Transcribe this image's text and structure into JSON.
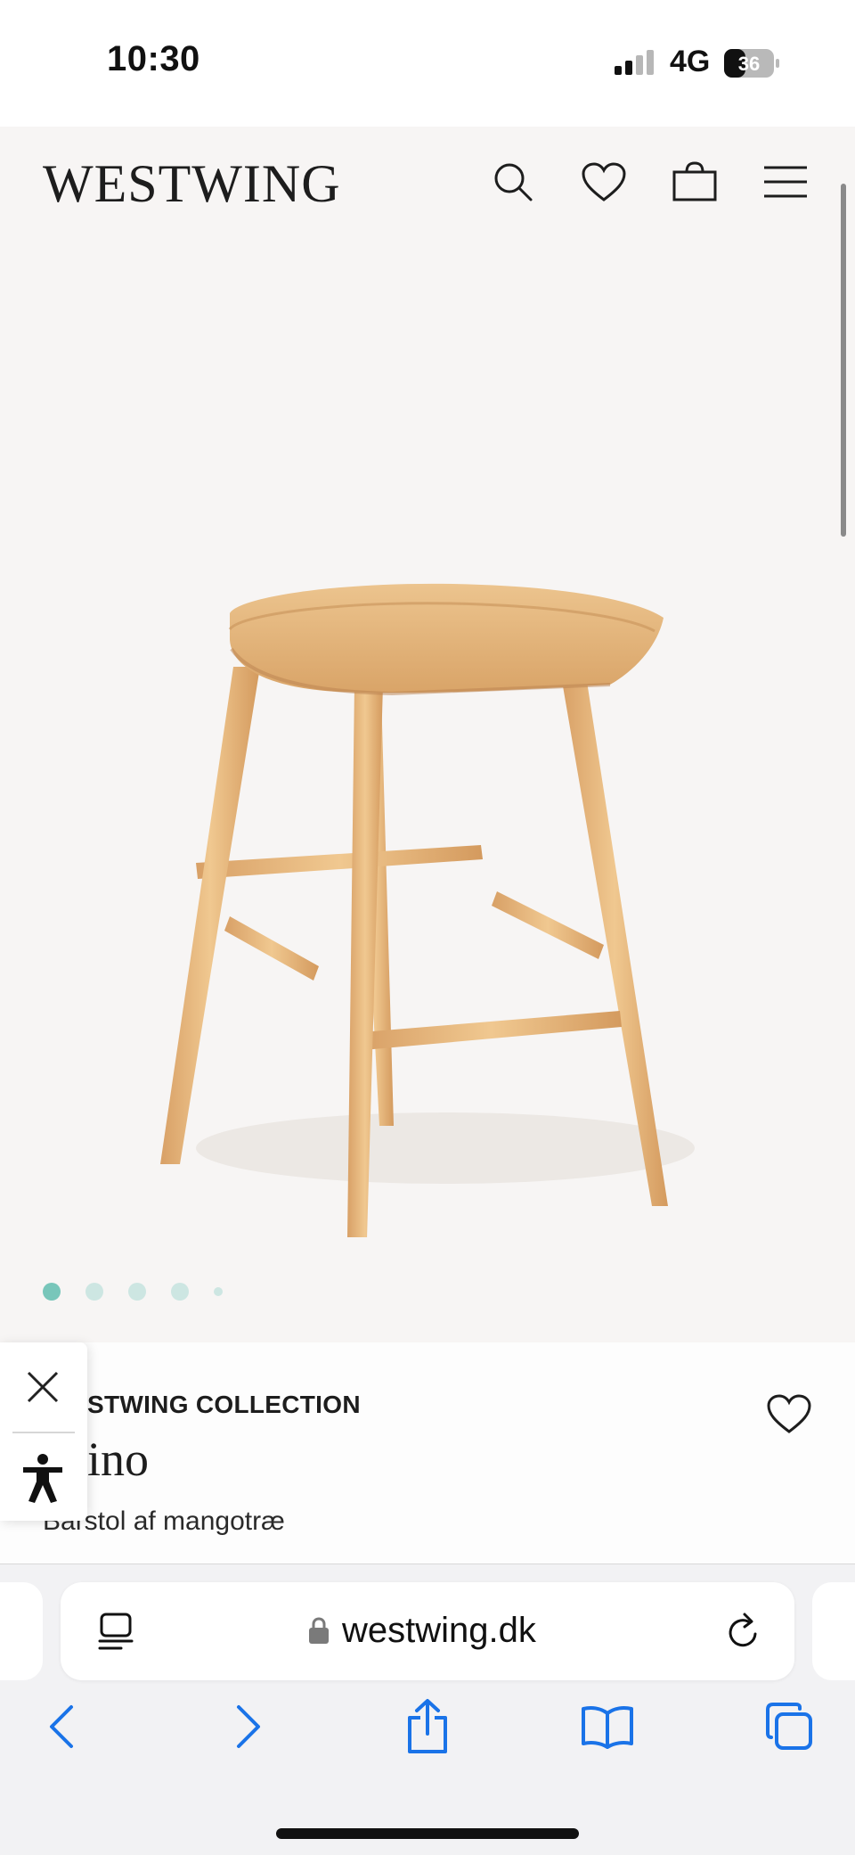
{
  "status_bar": {
    "time": "10:30",
    "network": "4G",
    "battery": "36"
  },
  "header": {
    "brand": "WESTWING",
    "icons": [
      "search-icon",
      "heart-icon",
      "bag-icon",
      "menu-icon"
    ]
  },
  "gallery": {
    "image_alt": "wooden bar stool",
    "slide_count": 5,
    "active_slide": 1
  },
  "product": {
    "brand_line": "STWING COLLECTION",
    "name": "ino",
    "subtitle": "Barstol af mangotræ"
  },
  "browser": {
    "url": "westwing.dk"
  },
  "colors": {
    "header_bg": "#f7f5f4",
    "dot_active": "#78c6ba",
    "dot_inactive": "#cde6e2",
    "browser_accent": "#1a73e8"
  }
}
